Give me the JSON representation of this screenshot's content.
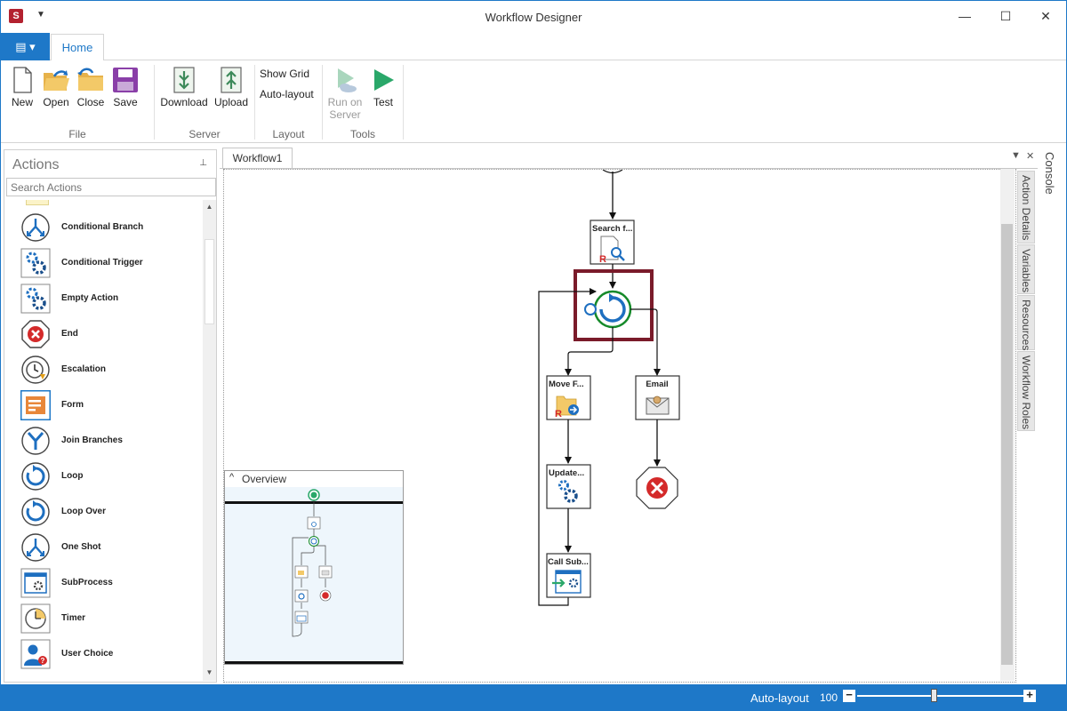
{
  "window": {
    "title": "Workflow Designer",
    "app_icon_glyph": "S",
    "qat_glyph": "▼",
    "controls": {
      "minimize": "—",
      "maximize": "☐",
      "close": "✕"
    }
  },
  "ribbon": {
    "file_tab_glyph": "▤ ▾",
    "tabs": [
      {
        "label": "Home",
        "active": true
      }
    ],
    "groups": {
      "file": {
        "label": "File",
        "buttons": [
          "New",
          "Open",
          "Close",
          "Save"
        ]
      },
      "server": {
        "label": "Server",
        "buttons": [
          "Download",
          "Upload"
        ]
      },
      "layout": {
        "label": "Layout",
        "buttons": [
          "Show Grid",
          "Auto-layout"
        ]
      },
      "tools": {
        "label": "Tools",
        "run_on_server": [
          "Run on",
          "Server"
        ],
        "test": "Test"
      }
    }
  },
  "actions_panel": {
    "title": "Actions",
    "pin_glyph": "⊥",
    "search_placeholder": "Search Actions",
    "items": [
      {
        "label": "Conditional Branch",
        "icon": "conditional-branch-icon"
      },
      {
        "label": "Conditional Trigger",
        "icon": "gears-icon"
      },
      {
        "label": "Empty Action",
        "icon": "gears-icon"
      },
      {
        "label": "End",
        "icon": "end-icon"
      },
      {
        "label": "Escalation",
        "icon": "escalation-clock-icon"
      },
      {
        "label": "Form",
        "icon": "form-icon"
      },
      {
        "label": "Join Branches",
        "icon": "join-branches-icon"
      },
      {
        "label": "Loop",
        "icon": "loop-icon"
      },
      {
        "label": "Loop Over",
        "icon": "loop-over-icon"
      },
      {
        "label": "One Shot",
        "icon": "one-shot-icon"
      },
      {
        "label": "SubProcess",
        "icon": "subprocess-icon"
      },
      {
        "label": "Timer",
        "icon": "timer-icon"
      },
      {
        "label": "User Choice",
        "icon": "user-choice-icon"
      }
    ],
    "scroll_up": "▲",
    "scroll_down": "▼"
  },
  "document": {
    "tab": "Workflow1",
    "controls": {
      "dropdown": "▼",
      "close": "✕"
    }
  },
  "side_tabs": [
    "Action Details",
    "Variables",
    "Resources",
    "Workflow Roles"
  ],
  "console_tab": "Console",
  "workflow": {
    "nodes": {
      "search": "Search f...",
      "move": "Move F...",
      "email": "Email",
      "update": "Update...",
      "call_sub": "Call Sub..."
    }
  },
  "overview": {
    "title": "Overview",
    "collapse_glyph": "^"
  },
  "status_bar": {
    "auto_layout": "Auto-layout",
    "zoom": "100",
    "zoom_out": "−",
    "zoom_in": "+",
    "zoom_level": 100
  },
  "colors": {
    "accent": "#1e78c8",
    "loop_ring": "#168a2a",
    "loop_blue": "#1e6fc0",
    "selection": "#7a1b2a",
    "end_red": "#d42a2a"
  }
}
